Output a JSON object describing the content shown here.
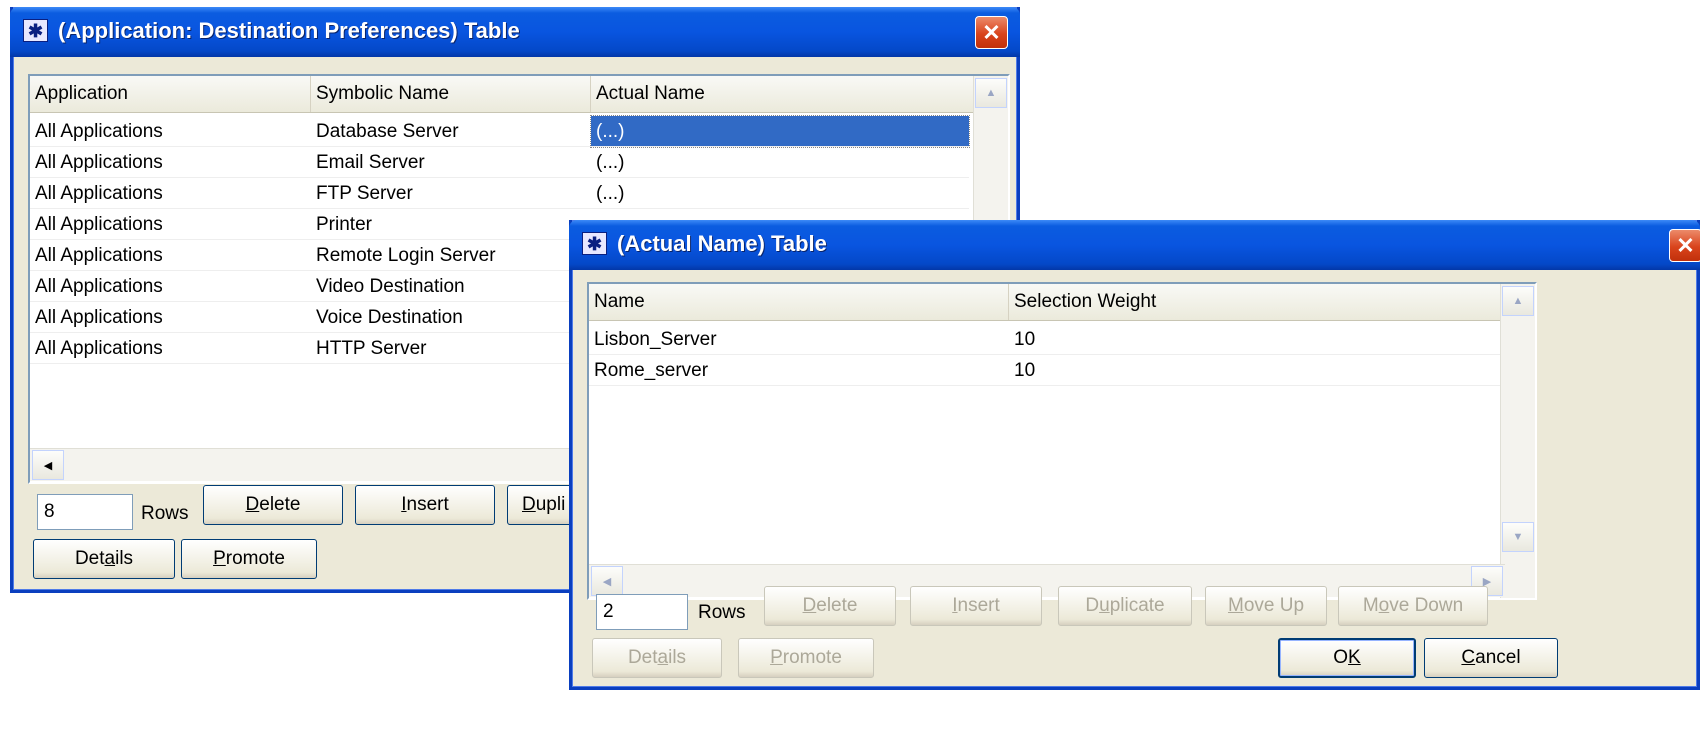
{
  "window1": {
    "title": "(Application: Destination Preferences) Table",
    "columns": [
      "Application",
      "Symbolic Name",
      "Actual Name"
    ],
    "rows": [
      [
        "All Applications",
        "Database Server",
        "(...)"
      ],
      [
        "All Applications",
        "Email Server",
        "(...)"
      ],
      [
        "All Applications",
        "FTP Server",
        "(...)"
      ],
      [
        "All Applications",
        "Printer",
        ""
      ],
      [
        "All Applications",
        "Remote Login Server",
        ""
      ],
      [
        "All Applications",
        "Video Destination",
        ""
      ],
      [
        "All Applications",
        "Voice Destination",
        ""
      ],
      [
        "All Applications",
        "HTTP Server",
        ""
      ]
    ],
    "rows_count": "8",
    "rows_label": "Rows",
    "buttons": {
      "delete": {
        "pre": "",
        "key": "D",
        "post": "elete"
      },
      "insert": {
        "pre": "",
        "key": "I",
        "post": "nsert"
      },
      "duplicate": {
        "pre": "",
        "key": "D",
        "post": "upli"
      },
      "details": {
        "pre": "Det",
        "key": "a",
        "post": "ils"
      },
      "promote": {
        "pre": "",
        "key": "P",
        "post": "romote"
      }
    }
  },
  "window2": {
    "title": "(Actual Name) Table",
    "columns": [
      "Name",
      "Selection Weight"
    ],
    "rows": [
      [
        "Lisbon_Server",
        "10"
      ],
      [
        "Rome_server",
        "10"
      ]
    ],
    "rows_count": "2",
    "rows_label": "Rows",
    "buttons": {
      "delete": {
        "pre": "",
        "key": "D",
        "post": "elete"
      },
      "insert": {
        "pre": "",
        "key": "I",
        "post": "nsert"
      },
      "duplicate": {
        "pre": "D",
        "key": "u",
        "post": "plicate"
      },
      "move_up": {
        "pre": "",
        "key": "M",
        "post": "ove Up"
      },
      "move_down": {
        "pre": "M",
        "key": "o",
        "post": "ve Down"
      },
      "details": {
        "pre": "Det",
        "key": "a",
        "post": "ils"
      },
      "promote": {
        "pre": "",
        "key": "P",
        "post": "romote"
      },
      "ok": {
        "pre": "O",
        "key": "K",
        "post": ""
      },
      "cancel": {
        "pre": "",
        "key": "C",
        "post": "ancel"
      }
    }
  },
  "icons": {
    "close": "✕",
    "window_icon": "✱",
    "arrow_up": "▲",
    "arrow_down": "▼",
    "arrow_left": "◀",
    "arrow_right": "▶"
  },
  "colors": {
    "title_blue": "#0955e0",
    "close_red": "#d9441c",
    "selection": "#316ac5",
    "dialog_bg": "#ece9d8"
  }
}
